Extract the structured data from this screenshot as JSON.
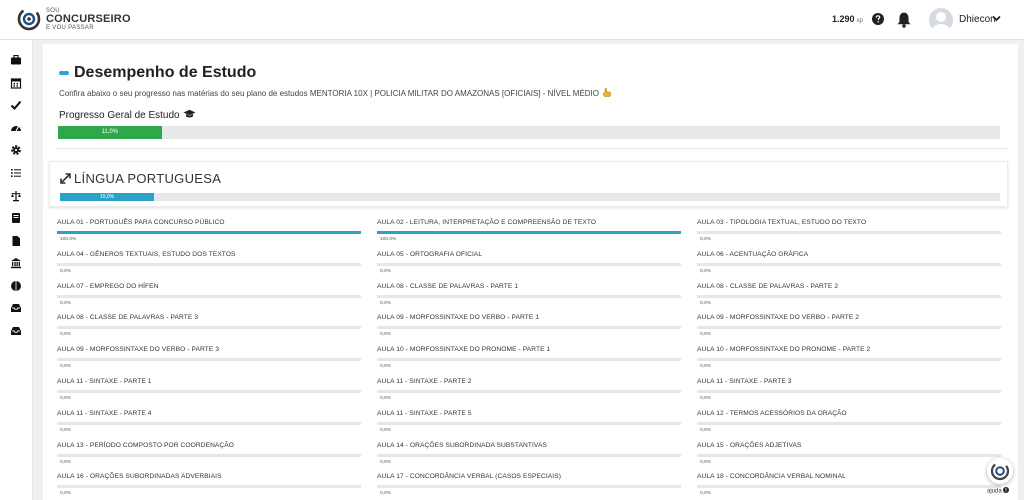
{
  "brand": {
    "line1": "SOU",
    "line2": "CONCURSEIRO",
    "line3": "E VOU PASSAR"
  },
  "header": {
    "xp_value": "1.290",
    "xp_unit": "xp",
    "username": "Dhiecon",
    "icons": [
      "help-icon",
      "bell-icon",
      "avatar",
      "chevron-down-icon"
    ]
  },
  "sidebar": {
    "items": [
      {
        "icon": "briefcase-icon"
      },
      {
        "icon": "calendar-icon"
      },
      {
        "icon": "check-icon"
      },
      {
        "icon": "dashboard-icon"
      },
      {
        "icon": "gear-icon"
      },
      {
        "icon": "list-icon"
      },
      {
        "icon": "balance-icon"
      },
      {
        "icon": "book-icon"
      },
      {
        "icon": "file-icon"
      },
      {
        "icon": "bank-icon"
      },
      {
        "icon": "brain-icon"
      },
      {
        "icon": "inbox-icon"
      },
      {
        "icon": "inbox-alt-icon"
      }
    ]
  },
  "page": {
    "title": "Desempenho de Estudo",
    "subtitle": "Confira abaixo o seu progresso nas matérias do seu plano de estudos MENTORIA 10X | POLICIA MILITAR DO AMAZONAS [OFICIAIS] - NÍVEL MÉDIO",
    "overall_label": "Progresso Geral de Estudo",
    "overall_progress_text": "11,0%",
    "overall_progress": 11.0
  },
  "subject": {
    "title": "LÍNGUA PORTUGUESA",
    "progress_text": "10,0%",
    "progress": 10.0,
    "lessons": [
      {
        "name": "AULA 01 - PORTUGUÊS PARA CONCURSO PÚBLICO",
        "pct_text": "100,0%",
        "pct": 100
      },
      {
        "name": "AULA 02 - LEITURA, INTERPRETAÇÃO E COMPREENSÃO DE TEXTO",
        "pct_text": "100,0%",
        "pct": 100
      },
      {
        "name": "AULA 03 - TIPOLOGIA TEXTUAL, ESTUDO DO TEXTO",
        "pct_text": "0,0%",
        "pct": 0
      },
      {
        "name": "AULA 04 - GÊNEROS TEXTUAIS, ESTUDO DOS TEXTOS",
        "pct_text": "0,0%",
        "pct": 0
      },
      {
        "name": "AULA 05 - ORTOGRAFIA OFICIAL",
        "pct_text": "0,0%",
        "pct": 0
      },
      {
        "name": "AULA 06 - ACENTUAÇÃO GRÁFICA",
        "pct_text": "0,0%",
        "pct": 0
      },
      {
        "name": "AULA 07 - EMPREGO DO HÍFEN",
        "pct_text": "0,0%",
        "pct": 0
      },
      {
        "name": "AULA 08 - CLASSE DE PALAVRAS - PARTE 1",
        "pct_text": "0,0%",
        "pct": 0
      },
      {
        "name": "AULA 08 - CLASSE DE PALAVRAS - PARTE 2",
        "pct_text": "0,0%",
        "pct": 0
      },
      {
        "name": "AULA 08 - CLASSE DE PALAVRAS - PARTE 3",
        "pct_text": "0,0%",
        "pct": 0
      },
      {
        "name": "AULA 09 - MORFOSSINTAXE DO VERBO - PARTE 1",
        "pct_text": "0,0%",
        "pct": 0
      },
      {
        "name": "AULA 09 - MORFOSSINTAXE DO VERBO - PARTE 2",
        "pct_text": "0,0%",
        "pct": 0
      },
      {
        "name": "AULA 09 - MORFOSSINTAXE DO VERBO - PARTE 3",
        "pct_text": "0,0%",
        "pct": 0
      },
      {
        "name": "AULA 10 - MORFOSSINTAXE DO PRONOME - PARTE 1",
        "pct_text": "0,0%",
        "pct": 0
      },
      {
        "name": "AULA 10 - MORFOSSINTAXE DO PRONOME - PARTE 2",
        "pct_text": "0,0%",
        "pct": 0
      },
      {
        "name": "AULA 11 - SINTAXE - PARTE 1",
        "pct_text": "0,0%",
        "pct": 0
      },
      {
        "name": "AULA 11 - SINTAXE - PARTE 2",
        "pct_text": "0,0%",
        "pct": 0
      },
      {
        "name": "AULA 11 - SINTAXE - PARTE 3",
        "pct_text": "0,0%",
        "pct": 0
      },
      {
        "name": "AULA 11 - SINTAXE - PARTE 4",
        "pct_text": "0,0%",
        "pct": 0
      },
      {
        "name": "AULA 11 - SINTAXE - PARTE 5",
        "pct_text": "0,0%",
        "pct": 0
      },
      {
        "name": "AULA 12 - TERMOS ACESSÓRIOS DA ORAÇÃO",
        "pct_text": "0,0%",
        "pct": 0
      },
      {
        "name": "AULA 13 - PERÍODO COMPOSTO POR COORDENAÇÃO",
        "pct_text": "0,0%",
        "pct": 0
      },
      {
        "name": "AULA 14 - ORAÇÕES SUBORDINADA SUBSTANTIVAS",
        "pct_text": "0,0%",
        "pct": 0
      },
      {
        "name": "AULA 15 - ORAÇÕES ADJETIVAS",
        "pct_text": "0,0%",
        "pct": 0
      },
      {
        "name": "AULA 16 - ORAÇÕES SUBORDINADAS ADVERBIAIS",
        "pct_text": "0,0%",
        "pct": 0
      },
      {
        "name": "AULA 17 - CONCORDÂNCIA VERBAL (CASOS ESPECIAIS)",
        "pct_text": "0,0%",
        "pct": 0
      },
      {
        "name": "AULA 18 - CONCORDÂNCIA VERBAL NOMINAL",
        "pct_text": "0,0%",
        "pct": 0
      }
    ]
  },
  "help_widget": {
    "label": "ajuda"
  },
  "colors": {
    "accent": "#29a6d8",
    "progress_green": "#2ea84a",
    "progress_blue": "#2ba3c8",
    "brand_blue": "#1e4f8a"
  }
}
